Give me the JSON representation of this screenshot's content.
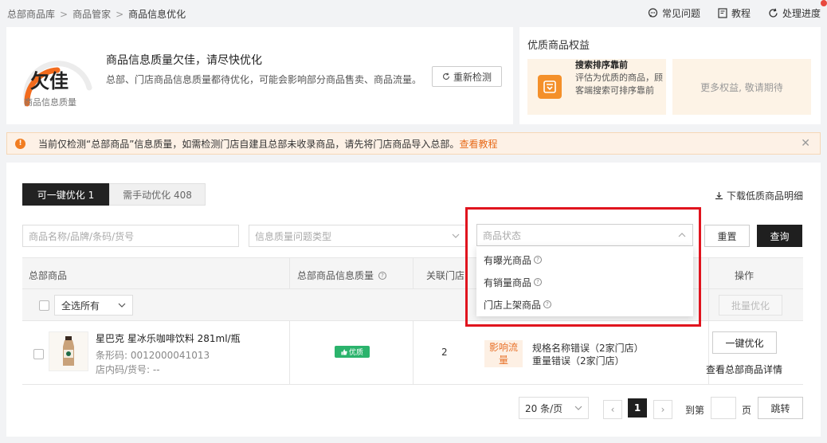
{
  "breadcrumb": {
    "items": [
      "总部商品库",
      "商品管家",
      "商品信息优化"
    ],
    "separator": ">"
  },
  "top_links": {
    "faq": "常见问题",
    "tutorial": "教程",
    "progress": "处理进度"
  },
  "quality_card": {
    "grade": "欠佳",
    "grade_label": "商品信息质量",
    "title": "商品信息质量欠佳，请尽快优化",
    "desc": "总部、门店商品信息质量都待优化，可能会影响部分商品售卖、商品流量。",
    "recheck_label": "重新检测"
  },
  "benefits": {
    "title": "优质商品权益",
    "item1_title": "搜索排序靠前",
    "item1_desc": "评估为优质的商品，顾客端搜索可排序靠前",
    "item2_text": "更多权益, 敬请期待"
  },
  "notice": {
    "text": "当前仅检测“总部商品”信息质量，如需检测门店自建且总部未收录商品，请先将门店商品导入总部。",
    "link": "查看教程"
  },
  "tabs": {
    "one_click": "可一键优化 1",
    "manual": "需手动优化 408"
  },
  "download_label": "下载低质商品明细",
  "filters": {
    "search_placeholder": "商品名称/品牌/条码/货号",
    "type_placeholder": "信息质量问题类型",
    "status_placeholder": "商品状态",
    "reset": "重置",
    "query": "查询"
  },
  "status_dropdown": {
    "options": [
      "有曝光商品",
      "有销量商品",
      "门店上架商品"
    ]
  },
  "table": {
    "headers": {
      "product": "总部商品",
      "quality": "总部商品信息质量",
      "stores": "关联门店",
      "action": "操作"
    },
    "select_all": "全选所有",
    "batch_optimize": "批量优化",
    "row": {
      "name": "星巴克 星冰乐咖啡饮料 281ml/瓶",
      "barcode": "条形码: 0012000041013",
      "store_code": "店内码/货号: --",
      "quality_badge": "优质",
      "store_count": "2",
      "impact_line1": "影响流",
      "impact_line2": "量",
      "error1": "规格名称错误（2家门店）",
      "error2": "重量错误（2家门店）",
      "optimize_button": "一键优化",
      "detail_link": "查看总部商品详情"
    }
  },
  "pagination": {
    "page_size": "20 条/页",
    "prev": "‹",
    "current": "1",
    "next": "›",
    "goto_label": "到第",
    "page_unit": "页",
    "jump": "跳转"
  },
  "colors": {
    "accent_orange": "#e86b1a",
    "dark": "#1f1f1f",
    "success_green": "#2bb36c",
    "highlight_red": "#e0141e"
  }
}
